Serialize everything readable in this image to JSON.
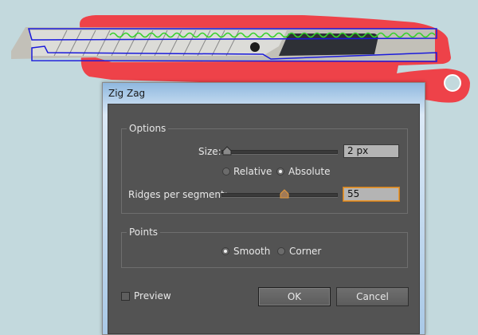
{
  "dialog": {
    "title": "Zig Zag",
    "options": {
      "legend": "Options",
      "size_label": "Size:",
      "size_value": "2 px",
      "size_slider_level": 0.03,
      "relative_label": "Relative",
      "absolute_label": "Absolute",
      "mode_selected": "Absolute",
      "ridges_label": "Ridges per segment:",
      "ridges_value": "55",
      "ridges_slider_level": 0.55
    },
    "points": {
      "legend": "Points",
      "smooth_label": "Smooth",
      "corner_label": "Corner",
      "selected": "Smooth"
    },
    "preview_label": "Preview",
    "preview_checked": false,
    "ok_label": "OK",
    "cancel_label": "Cancel"
  },
  "colors": {
    "background": "#c3d9dd",
    "cutter_body": "#ee4249",
    "selection_outline": "#1a1adb",
    "zigzag_path": "#34d12a",
    "dialog_client": "#535353",
    "focus_accent": "#e69a39"
  }
}
